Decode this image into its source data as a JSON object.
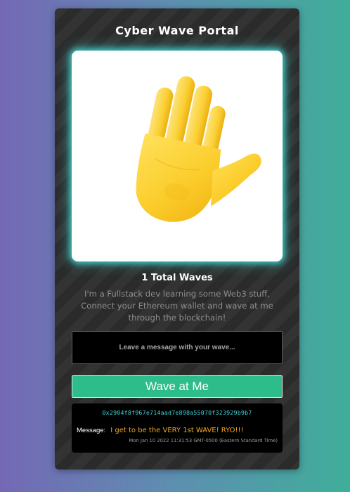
{
  "app": {
    "title": "Cyber Wave Portal"
  },
  "hero": {
    "image": "waving-hand-icon"
  },
  "stats": {
    "total_waves": "1 Total Waves"
  },
  "bio": {
    "text": "I'm a Fullstack dev learning some Web3 stuff, Connect your Ethereum wallet and wave at me through the blockchain!"
  },
  "input": {
    "placeholder": "Leave a message with your wave...",
    "value": ""
  },
  "button": {
    "wave_label": "Wave at Me"
  },
  "waves": [
    {
      "address": "0x2904f8f967e714aad7e898a55070f323929b9b7",
      "message_label": "Message:",
      "message": "I get to be the VERY 1st WAVE! RYO!!!",
      "timestamp": "Mon Jan 10 2022 11:31:53 GMT-0500 (Eastern Standard Time)"
    }
  ],
  "colors": {
    "accent_button": "#2dbd8b",
    "glow": "#40d6d0",
    "address": "#3fd4d8",
    "message": "#f5a623"
  }
}
